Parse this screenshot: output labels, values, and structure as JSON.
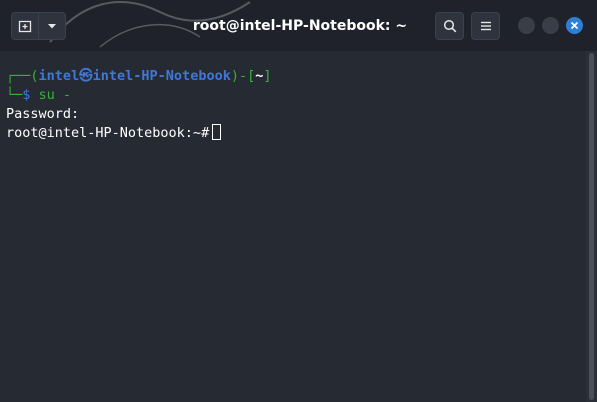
{
  "window": {
    "title": "root@intel-HP-Notebook: ~"
  },
  "titlebar": {
    "new_tab_icon": "new-tab-icon",
    "dropdown_icon": "chevron-down-icon",
    "search_icon": "search-icon",
    "menu_icon": "hamburger-menu-icon",
    "minimize_icon": "minimize-icon",
    "maximize_icon": "maximize-icon",
    "close_icon": "close-icon",
    "close_color": "#2d7fd6"
  },
  "terminal": {
    "prompt": {
      "box_top": "┌──(",
      "user": "intel",
      "separator_glyph": "㉿",
      "host": "intel-HP-Notebook",
      "mid": ")-[",
      "dir": "~",
      "end": "]",
      "box_bottom": "└─",
      "dollar": "$",
      "command": "su -"
    },
    "password_label": "Password:",
    "root_prompt": "root@intel-HP-Notebook:~#",
    "colors": {
      "green": "#38b238",
      "blue": "#3f78d6",
      "background": "#262a33"
    }
  }
}
